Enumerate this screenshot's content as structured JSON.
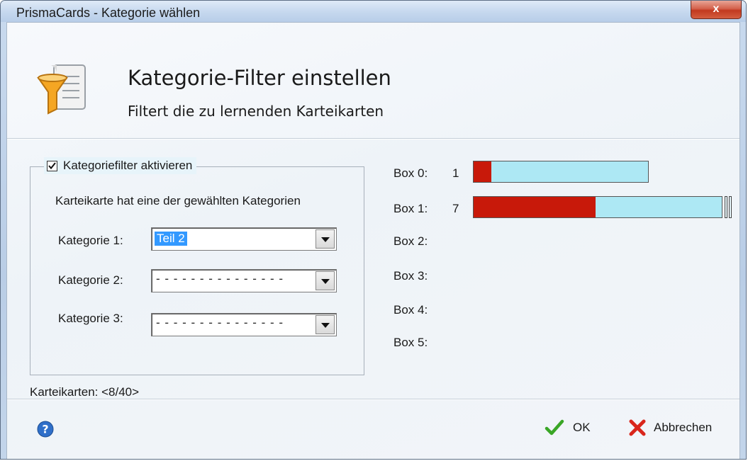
{
  "window": {
    "title": "PrismaCards - Kategorie wählen",
    "close_label": "x"
  },
  "header": {
    "title": "Kategorie-Filter einstellen",
    "subtitle": "Filtert die zu lernenden Karteikarten",
    "icon": "filter-funnel-scroll-icon"
  },
  "filter": {
    "activate_label": "Kategoriefilter aktivieren",
    "activate_checked": true,
    "description": "Karteikarte hat eine der gewählten Kategorien",
    "categories": [
      {
        "label": "Kategorie 1:",
        "value": "Teil 2"
      },
      {
        "label": "Kategorie 2:",
        "value": "- - - - - - - - - - - - - - -"
      },
      {
        "label": "Kategorie 3:",
        "value": "- - - - - - - - - - - - - - -"
      }
    ],
    "card_count": "Karteikarten: <8/40>"
  },
  "boxes": [
    {
      "label": "Box 0:",
      "count": "1",
      "filled_fraction": 0.1
    },
    {
      "label": "Box 1:",
      "count": "7",
      "filled_fraction": 0.49
    },
    {
      "label": "Box 2:",
      "count": ""
    },
    {
      "label": "Box 3:",
      "count": ""
    },
    {
      "label": "Box 4:",
      "count": ""
    },
    {
      "label": "Box 5:",
      "count": ""
    }
  ],
  "footer": {
    "help_icon": "help-icon",
    "ok_label": "OK",
    "cancel_label": "Abbrechen"
  },
  "colors": {
    "bar_filled": "#c8190a",
    "bar_empty": "#ade8f4",
    "selection": "#3399ff"
  }
}
